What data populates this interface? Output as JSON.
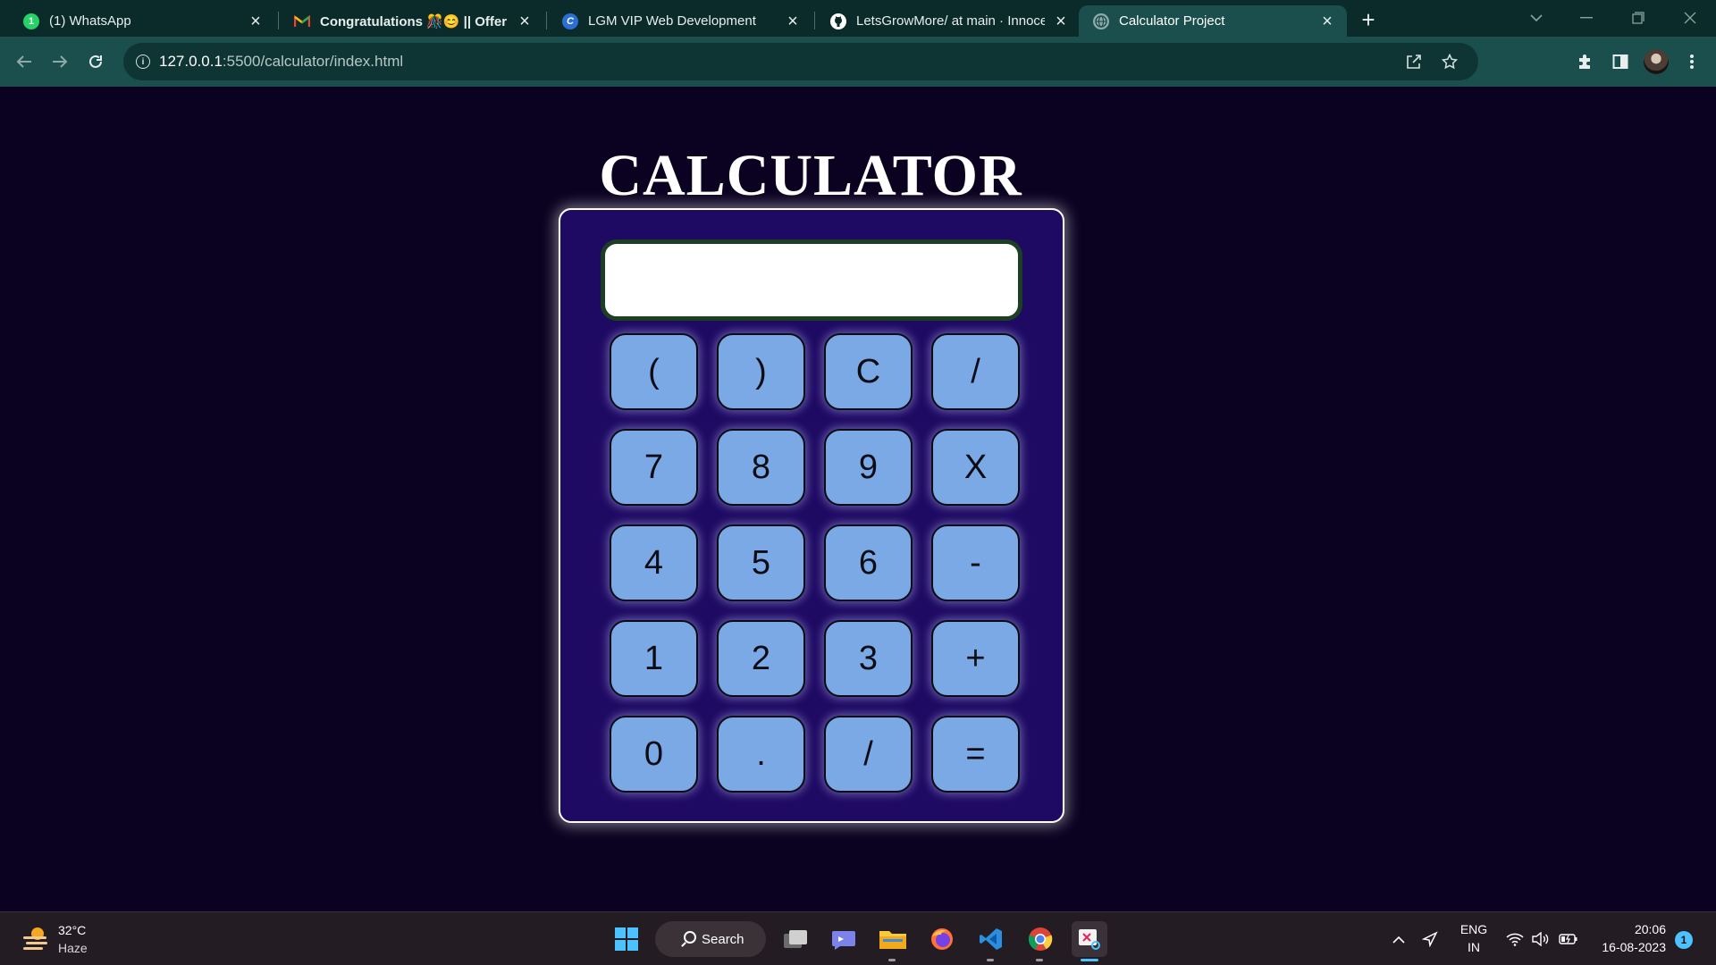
{
  "browser": {
    "tabs": [
      {
        "title": "(1) WhatsApp",
        "icon": "whatsapp-icon",
        "active": false
      },
      {
        "title": "Congratulations 🎊😊 || Offer Le",
        "icon": "gmail-icon",
        "active": false
      },
      {
        "title": "LGM VIP Web Development",
        "icon": "lgm-icon",
        "active": false
      },
      {
        "title": "LetsGrowMore/ at main · Innocen",
        "icon": "github-icon",
        "active": false
      },
      {
        "title": "Calculator Project",
        "icon": "globe-icon",
        "active": true
      }
    ],
    "address": {
      "host": "127.0.0.1",
      "path": ":5500/calculator/index.html"
    }
  },
  "calculator": {
    "title": "CALCULATOR",
    "display_value": "",
    "keys": [
      "(",
      ")",
      "C",
      "/",
      "7",
      "8",
      "9",
      "X",
      "4",
      "5",
      "6",
      "-",
      "1",
      "2",
      "3",
      "+",
      "0",
      ".",
      "/",
      "="
    ]
  },
  "taskbar": {
    "weather": {
      "temp": "32°C",
      "desc": "Haze"
    },
    "search_label": "Search",
    "language": {
      "line1": "ENG",
      "line2": "IN"
    },
    "clock": {
      "time": "20:06",
      "date": "16-08-2023"
    },
    "notification_count": "1"
  },
  "colors": {
    "page_bg": "#0a0220",
    "calculator_body": "#1f0a63",
    "key_bg": "#7aa9e6",
    "display_border": "#1c3e22",
    "browser_frame": "#0b2b2a",
    "active_tab": "#1a4f4d"
  }
}
